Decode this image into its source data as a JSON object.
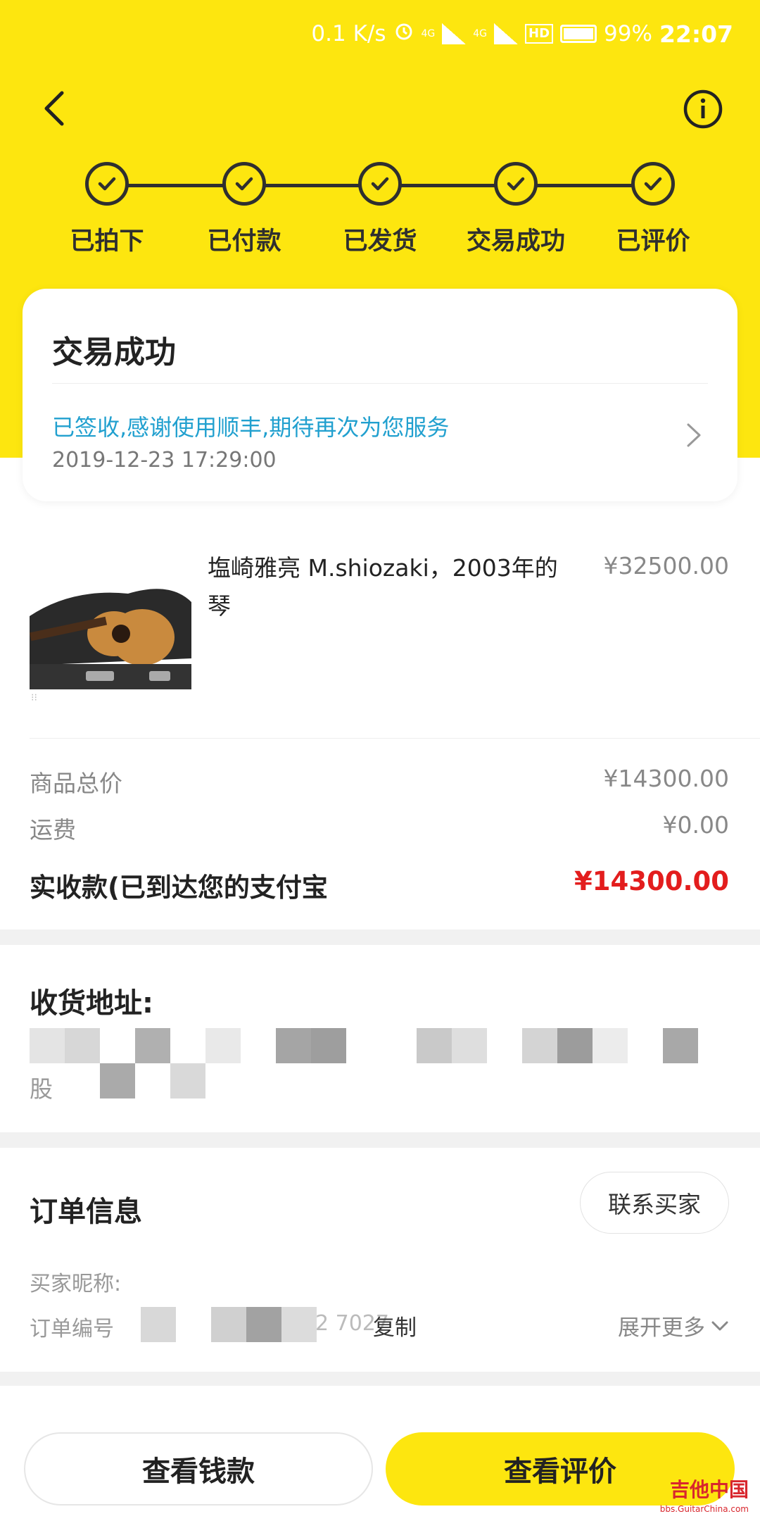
{
  "status_bar": {
    "speed": "0.1 K/s",
    "net1": "4G",
    "net2": "4G",
    "hd": "HD",
    "battery": "99%",
    "time": "22:07"
  },
  "steps": [
    "已拍下",
    "已付款",
    "已发货",
    "交易成功",
    "已评价"
  ],
  "status_card": {
    "title": "交易成功",
    "message": "已签收,感谢使用顺丰,期待再次为您服务",
    "timestamp": "2019-12-23 17:29:00"
  },
  "product": {
    "title": "塩崎雅亮 M.shiozaki，2003年的琴",
    "price": "¥32500.00"
  },
  "prices": {
    "subtotal_label": "商品总价",
    "subtotal_value": "¥14300.00",
    "shipping_label": "运费",
    "shipping_value": "¥0.00",
    "received_label": "实收款(已到达您的支付宝",
    "received_value": "¥14300.00"
  },
  "address": {
    "heading": "收货地址:",
    "line2_prefix": "股"
  },
  "order": {
    "heading": "订单信息",
    "contact_label": "联系买家",
    "buyer_nick_label": "买家昵称:",
    "order_no_label": "订单编号",
    "order_no_tail": "2     7027",
    "copy_label": "复制",
    "expand_label": "展开更多"
  },
  "bottom": {
    "left_label": "查看钱款",
    "right_label": "查看评价"
  },
  "watermark": {
    "text": "吉他中国",
    "sub": "bbs.GuitarChina.com"
  },
  "colors": {
    "brand_yellow": "#fde60f",
    "link_blue": "#21a0cf",
    "price_red": "#e31d1d"
  }
}
